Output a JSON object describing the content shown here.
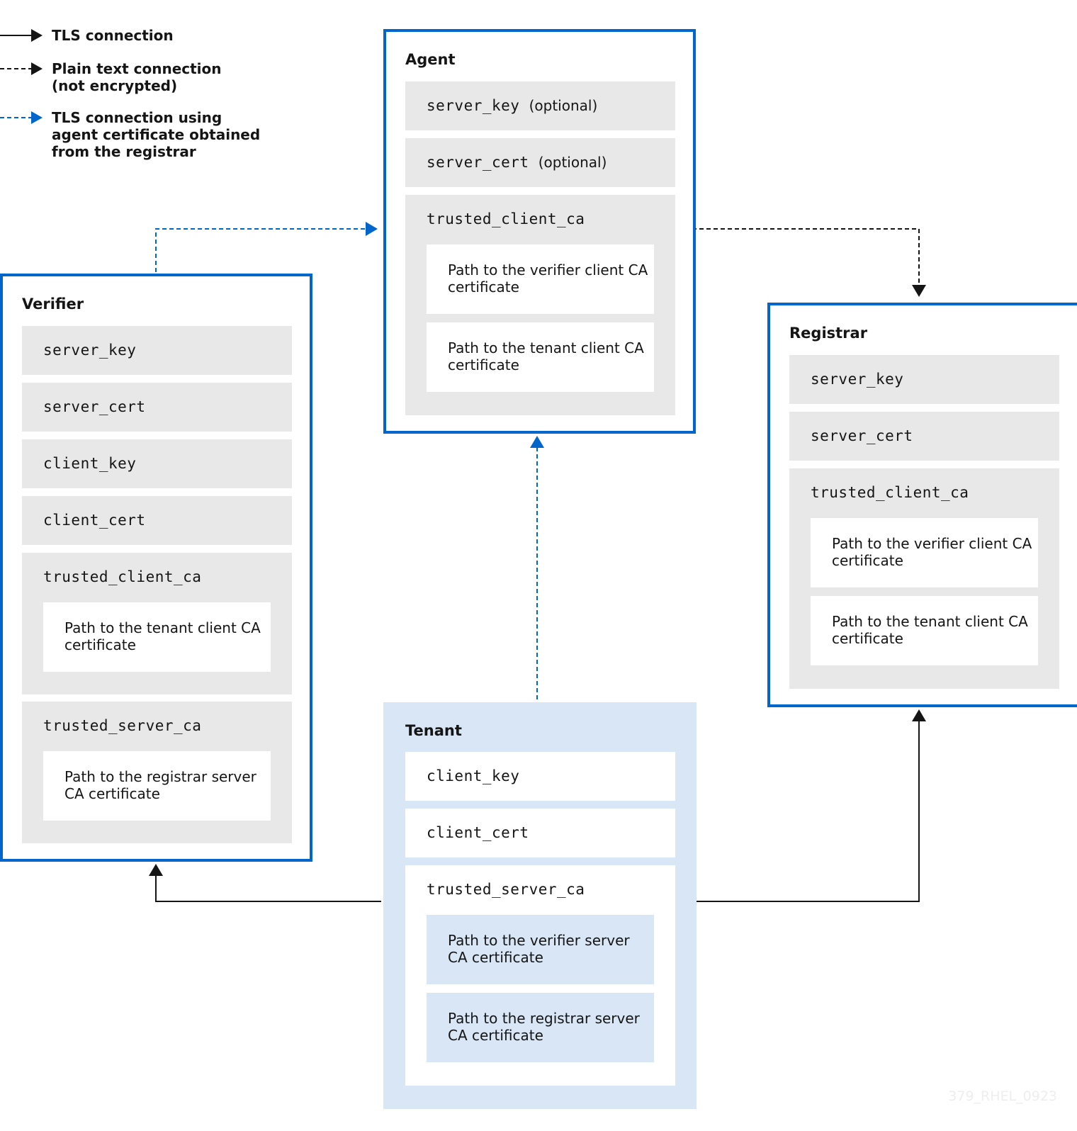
{
  "legend": [
    {
      "style": "solid-black",
      "icon": "arrow-right-solid-icon",
      "label_lines": [
        "TLS connection"
      ]
    },
    {
      "style": "dashed-black",
      "icon": "arrow-right-dashed-icon",
      "label_lines": [
        "Plain text connection",
        "(not encrypted)"
      ]
    },
    {
      "style": "dashed-blue",
      "icon": "arrow-right-dashed-blue-icon",
      "label_lines": [
        "TLS connection using",
        "agent certificate obtained",
        "from the registrar"
      ]
    }
  ],
  "colors": {
    "node_border": "#0066cc",
    "tenant_fill": "#d8e6f5",
    "field_gray": "#e8e8e8",
    "line_black": "#151515",
    "line_blue": "#0066cc"
  },
  "nodes": {
    "agent": {
      "title": "Agent",
      "fields": [
        {
          "name": "server_key",
          "note": "(optional)"
        },
        {
          "name": "server_cert",
          "note": "(optional)"
        },
        {
          "name": "trusted_client_ca",
          "items": [
            "Path to the verifier client CA certificate",
            "Path to the tenant client CA certificate"
          ]
        }
      ]
    },
    "verifier": {
      "title": "Verifier",
      "fields": [
        {
          "name": "server_key"
        },
        {
          "name": "server_cert"
        },
        {
          "name": "client_key"
        },
        {
          "name": "client_cert"
        },
        {
          "name": "trusted_client_ca",
          "items": [
            "Path to the tenant client CA certificate"
          ]
        },
        {
          "name": "trusted_server_ca",
          "items": [
            "Path to the registrar server CA certificate"
          ]
        }
      ]
    },
    "registrar": {
      "title": "Registrar",
      "fields": [
        {
          "name": "server_key"
        },
        {
          "name": "server_cert"
        },
        {
          "name": "trusted_client_ca",
          "items": [
            "Path to the verifier client CA certificate",
            "Path to the tenant client CA certificate"
          ]
        }
      ]
    },
    "tenant": {
      "title": "Tenant",
      "fields": [
        {
          "name": "client_key"
        },
        {
          "name": "client_cert"
        },
        {
          "name": "trusted_server_ca",
          "items": [
            "Path to the verifier server CA certificate",
            "Path to the registrar server CA certificate"
          ]
        }
      ]
    }
  },
  "connections": [
    {
      "from": "verifier",
      "to": "agent",
      "style": "dashed-blue"
    },
    {
      "from": "agent",
      "to": "registrar",
      "style": "dashed-black"
    },
    {
      "from": "tenant",
      "to": "agent",
      "style": "dashed-blue"
    },
    {
      "from": "tenant",
      "to": "verifier",
      "style": "solid-black"
    },
    {
      "from": "tenant",
      "to": "registrar",
      "style": "solid-black"
    }
  ],
  "watermark": "379_RHEL_0923"
}
